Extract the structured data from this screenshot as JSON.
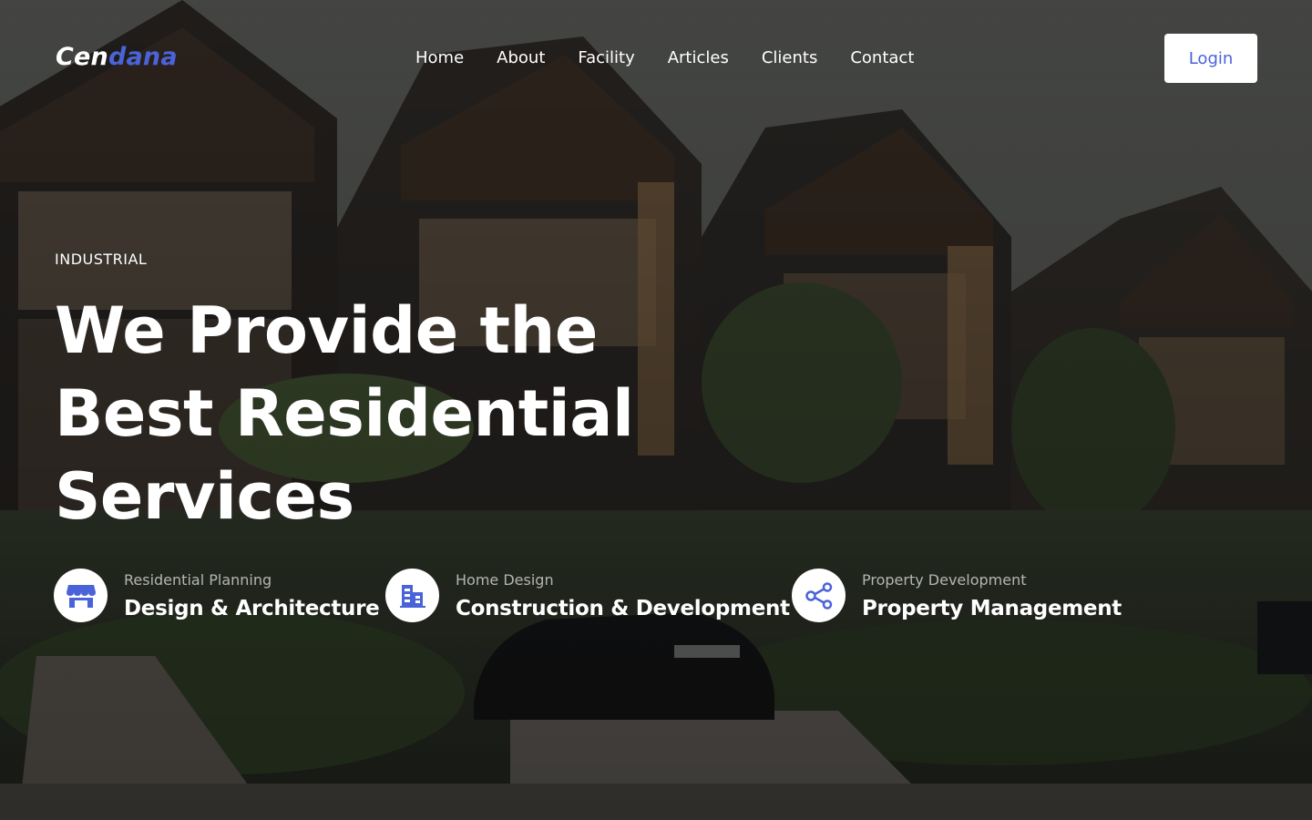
{
  "brand": {
    "logo_part1": "Cen",
    "logo_part2": "dana",
    "accent_color": "#4a63d8"
  },
  "nav": {
    "items": [
      {
        "label": "Home"
      },
      {
        "label": "About"
      },
      {
        "label": "Facility"
      },
      {
        "label": "Articles"
      },
      {
        "label": "Clients"
      },
      {
        "label": "Contact"
      }
    ],
    "login_label": "Login"
  },
  "hero": {
    "eyebrow": "INDUSTRIAL",
    "title_lines": [
      "We Provide the",
      "Best Residential",
      "Services"
    ]
  },
  "services": [
    {
      "icon": "storefront-icon",
      "subtitle": "Residential Planning",
      "title": "Design & Architecture"
    },
    {
      "icon": "building-icon",
      "subtitle": "Home Design",
      "title": "Construction & Development"
    },
    {
      "icon": "share-icon",
      "subtitle": "Property Development",
      "title": "Property Management"
    }
  ]
}
